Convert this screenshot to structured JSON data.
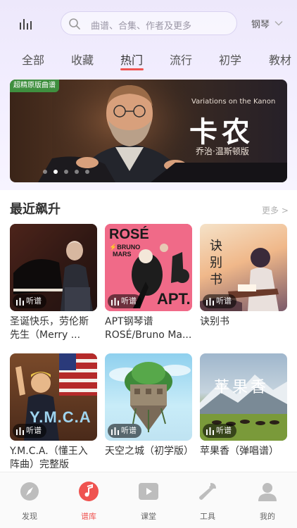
{
  "header": {
    "search_placeholder": "曲谱、合集、作者及更多",
    "instrument": "钢琴"
  },
  "tabs": [
    {
      "label": "全部"
    },
    {
      "label": "收藏"
    },
    {
      "label": "热门"
    },
    {
      "label": "流行"
    },
    {
      "label": "初学"
    },
    {
      "label": "教材"
    }
  ],
  "banner": {
    "badge": "超精原版曲谱",
    "subtitle": "Variations on the Kanon",
    "title": "卡农",
    "caption": "乔治·温斯顿版"
  },
  "section": {
    "title": "最近飙升",
    "more": "更多 >"
  },
  "cards": [
    {
      "title": "圣诞快乐，劳伦斯先生（Merry ...",
      "listen": "听谱",
      "art_text": ""
    },
    {
      "title": "APT钢琴谱ROSÉ/Bruno Ma...",
      "listen": "听谱",
      "art_text": "ROSÉ BRUNO MARS APT."
    },
    {
      "title": "诀别书",
      "listen": "听谱",
      "art_text": "诀别书"
    },
    {
      "title": "Y.M.C.A.（懂王入阵曲）完整版",
      "listen": "听谱",
      "art_text": "Y.M.C.A"
    },
    {
      "title": "天空之城（初学版）",
      "listen": "听谱",
      "art_text": ""
    },
    {
      "title": "苹果香（弹唱谱）",
      "listen": "听谱",
      "art_text": "苹果香"
    }
  ],
  "bottom_nav": [
    {
      "label": "发现",
      "icon": "compass-icon"
    },
    {
      "label": "谱库",
      "icon": "music-note-icon"
    },
    {
      "label": "课堂",
      "icon": "play-icon"
    },
    {
      "label": "工具",
      "icon": "wrench-icon"
    },
    {
      "label": "我的",
      "icon": "user-icon"
    }
  ],
  "colors": {
    "accent": "#ef5350",
    "banner_badge": "#3f8f3f"
  }
}
